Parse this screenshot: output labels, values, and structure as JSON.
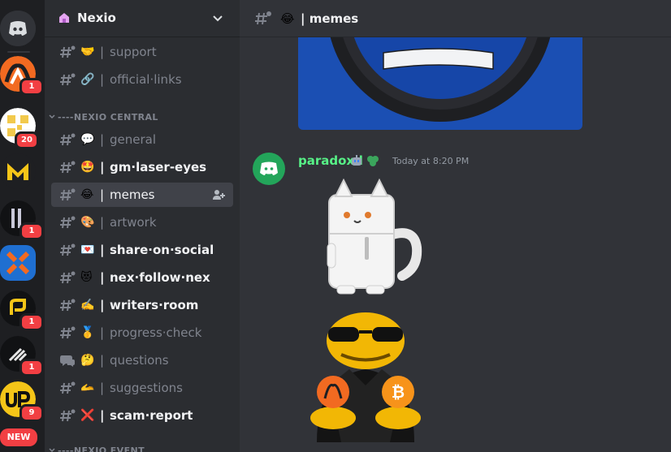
{
  "rail": {
    "servers": [
      {
        "name": "discord-home",
        "badge": ""
      },
      {
        "name": "nexio",
        "badge": "1"
      },
      {
        "name": "yellow-qr",
        "badge": "20"
      },
      {
        "name": "m-logo",
        "badge": ""
      },
      {
        "name": "pillars",
        "badge": "1"
      },
      {
        "name": "x-logo",
        "badge": ""
      },
      {
        "name": "gold-coin",
        "badge": "1"
      },
      {
        "name": "arrows",
        "badge": "1"
      },
      {
        "name": "up",
        "badge": "9"
      }
    ],
    "new_label": "NEW"
  },
  "sidebar": {
    "server_name": "Nexio",
    "channels_top": [
      {
        "emoji": "🤝",
        "name": "support",
        "state": "muted"
      },
      {
        "emoji": "🔗",
        "name": "official·links",
        "state": "muted"
      }
    ],
    "category_central": "----NEXIO CENTRAL",
    "channels": [
      {
        "emoji": "💬",
        "name": "general",
        "state": "muted"
      },
      {
        "emoji": "🤩",
        "name": "gm·laser-eyes",
        "state": "unread"
      },
      {
        "emoji": "😂",
        "name": "memes",
        "state": "active"
      },
      {
        "emoji": "🎨",
        "name": "artwork",
        "state": "muted"
      },
      {
        "emoji": "💌",
        "name": "share·on·social",
        "state": "unread"
      },
      {
        "emoji": "😻",
        "name": "nex·follow·nex",
        "state": "unread"
      },
      {
        "emoji": "✍️",
        "name": "writers·room",
        "state": "unread"
      },
      {
        "emoji": "🥇",
        "name": "progress·check",
        "state": "muted"
      },
      {
        "emoji": "🤔",
        "name": "questions",
        "state": "muted"
      },
      {
        "emoji": "🫴",
        "name": "suggestions",
        "state": "muted"
      },
      {
        "emoji": "❌",
        "name": "scam·report",
        "state": "unread"
      }
    ],
    "category_event": "----NEXIO EVENT",
    "pipe": "|"
  },
  "main": {
    "channel_emoji": "😂",
    "channel_title": "| memes",
    "message": {
      "author": "paradoxd",
      "timestamp": "Today at 8:20 PM"
    }
  },
  "colors": {
    "accent": "#5865f2",
    "author": "#57f287",
    "badge": "#f23f43"
  }
}
